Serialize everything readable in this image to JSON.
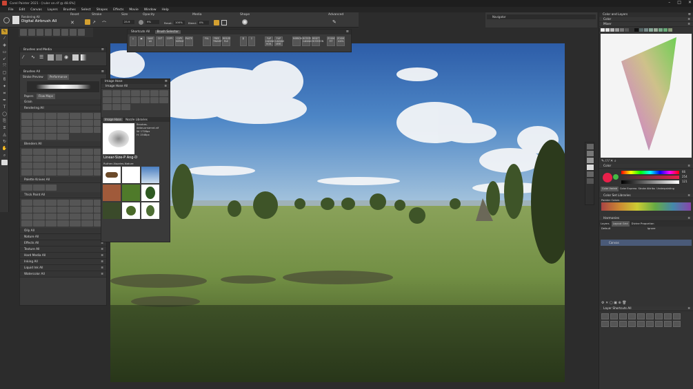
{
  "app": {
    "title": "Corel Painter 2021 - [ruler on.rif @ 48.6%]",
    "window_controls": [
      "–",
      "□",
      "✕"
    ]
  },
  "menu": [
    "File",
    "Edit",
    "Canvas",
    "Layers",
    "Brushes",
    "Select",
    "Shapes",
    "Effects",
    "Movie",
    "Window",
    "Help"
  ],
  "propbar": {
    "brush_category": "Rendering All",
    "brush_variant": "Digital Airbrush All",
    "reset_label": "Reset",
    "stroke_label": "Stroke",
    "size_label": "Size",
    "opacity_label": "Opacity",
    "media_label": "Media",
    "shape_label": "Shape",
    "advanced_label": "Advanced",
    "size_value": "25.9",
    "opacity_value": "9%",
    "resat_label": "Resat:",
    "resat_value": "100%",
    "bleed_label": "Bleed:",
    "bleed_value": "0%"
  },
  "navigator": {
    "title": "Navigator"
  },
  "left": {
    "brushes_media_title": "Brushes and Media",
    "brushes_all_title": "Brushes All",
    "stroke_preview_label": "Stroke Preview",
    "performance_label": "Performance",
    "papers_label": "Papers",
    "flow_maps_label": "Flow Maps",
    "grain_label": "Grain",
    "rendering_all": "Rendering All",
    "blenders_all": "Blenders All",
    "palette_knives_all": "Palette Knives All",
    "thick_paint_all": "Thick Paint All",
    "groups": [
      "Oily All",
      "Nature All",
      "Effects All",
      "Texture All",
      "Hard Media All",
      "Inking All",
      "Liquid Ink All",
      "Watercolor All"
    ]
  },
  "shortcuts": {
    "title": "Shortcuts All",
    "tab2": "Brush Selector",
    "buttons": [
      "SAVE AS",
      "CUT",
      "COPY",
      "COPY MERGE",
      "PASTE",
      "FILL",
      "FREE TRANSF",
      "RESIZE FILE",
      "FLIP CANVAS HOR.",
      "FLIP CANVAS VERT.",
      "MIRROR",
      "ROTATE CANVAS",
      "RESET ROTATION",
      "ZOOM FIT",
      "ZOOM 100%"
    ]
  },
  "imagehose": {
    "title": "Image Hose",
    "sub": "Image Hose All",
    "tab1": "Image Hose",
    "tab2": "Nozzle Libraries",
    "nozzle_file": "Brushes-datav.ornamnt.nif",
    "nozzle_w": "W: 1728px",
    "nozzle_h": "H: 1548px",
    "nozzle_name": "Linear-Size-P Ang-D",
    "library_name": "Ruthen-Nozzles-Nature"
  },
  "right": {
    "color_layers_title": "Color and Layers",
    "color_label": "Color",
    "mixer_label": "Mixer",
    "color2_label": "Color",
    "tabs": [
      "Color Variab",
      "Color Express",
      "Stroke Attribu",
      "Underpainting"
    ],
    "color_set_label": "Color Set Libraries",
    "painter_colors": "Painter Colors",
    "harmonies_label": "Harmonies",
    "layers_tabs": [
      "Layers",
      "Layout Grid",
      "Divine Proportion"
    ],
    "layer_default": "Default",
    "layer_ignore": "Ignore",
    "canvas_layer": "Canvas",
    "layer_shortcuts": "Layer Shortcuts All",
    "rgb": [
      "66",
      "254",
      "121"
    ]
  },
  "colors": {
    "accent_red": "#e8204a",
    "sky": "#3d6fb8"
  }
}
